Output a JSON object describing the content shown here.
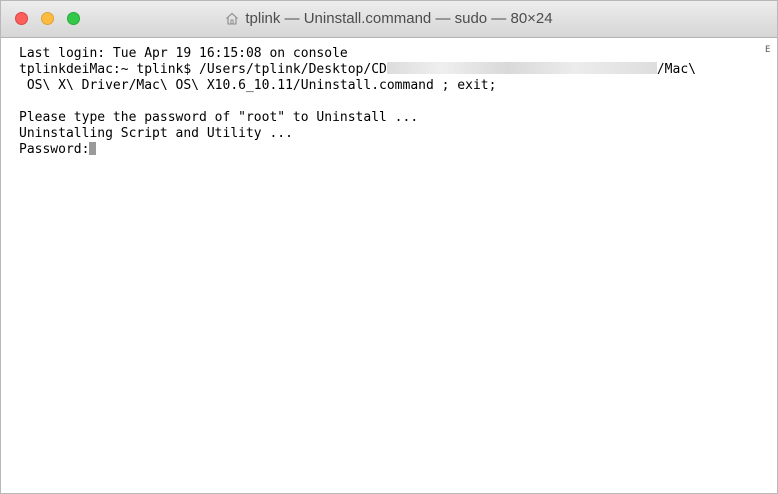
{
  "window": {
    "title": "tplink — Uninstall.command — sudo — 80×24",
    "title_icon": "home-icon",
    "traffic_lights": {
      "close_color": "#fc605c",
      "minimize_color": "#fdbc40",
      "maximize_color": "#34c84a"
    }
  },
  "terminal": {
    "line1": "Last login: Tue Apr 19 16:15:08 on console",
    "line2_prefix": "tplinkdeiMac:~ tplink$ /Users/tplink/Desktop/CD",
    "line2_suffix": "/Mac\\",
    "line3": " OS\\ X\\ Driver/Mac\\ OS\\ X10.6_10.11/Uninstall.command ; exit;",
    "line4": "",
    "line5": "Please type the password of \"root\" to Uninstall ...",
    "line6": "Uninstalling Script and Utility ...",
    "line7": "Password:",
    "scroll_marker": "E"
  }
}
